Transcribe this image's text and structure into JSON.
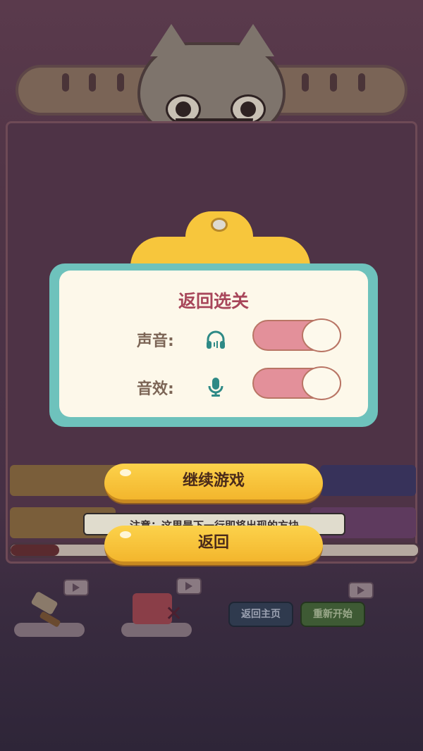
{
  "background": {
    "hint_text": "注意：这里是下一行即将出现的方块",
    "bottom_buttons": {
      "home_label": "返回主页",
      "restart_label": "重新开始"
    },
    "progress": 0.12
  },
  "dialog": {
    "title": "返回选关",
    "settings": [
      {
        "label": "声音:",
        "icon": "headphones-icon",
        "on": true
      },
      {
        "label": "音效:",
        "icon": "microphone-icon",
        "on": true
      }
    ]
  },
  "buttons": {
    "continue_label": "继续游戏",
    "back_label": "返回"
  },
  "colors": {
    "dialog_border": "#6ec2bc",
    "dialog_fill": "#fdf8ea",
    "title": "#a8465a",
    "toggle_on": "#e3909a",
    "button": "#f7c63c"
  }
}
